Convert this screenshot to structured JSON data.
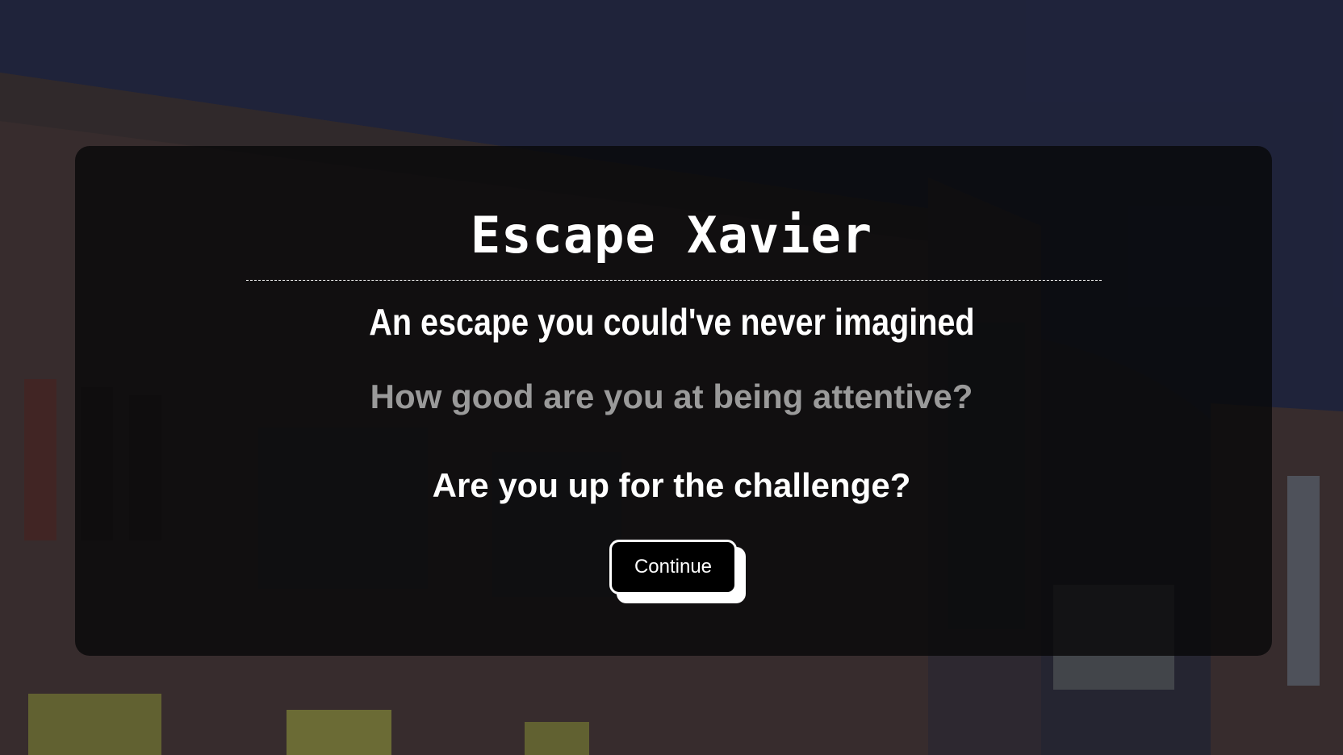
{
  "game": {
    "title": "Escape Xavier",
    "subtitle": "An escape you could've never imagined",
    "question": "How good are you at being attentive?",
    "challenge": "Are you up for the challenge?",
    "continue_label": "Continue"
  },
  "colors": {
    "panel_background": "#0a0a0c",
    "title_text": "#ffffff",
    "question_text": "#9a9a9a",
    "button_background": "#000000",
    "button_shadow": "#ffffff"
  },
  "background": {
    "scene": "school building at dusk"
  }
}
